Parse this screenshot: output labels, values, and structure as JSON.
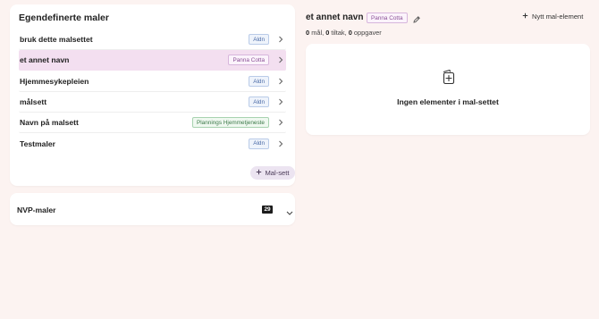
{
  "templates": {
    "title": "Egendefinerte maler",
    "items": [
      {
        "name": "bruk dette malsettet",
        "badge": "Aldn"
      },
      {
        "name": "et annet navn",
        "badge": "Panna Cotta"
      },
      {
        "name": "Hjemmesykepleien",
        "badge": "Aldn"
      },
      {
        "name": "målsett",
        "badge": "Aldn"
      },
      {
        "name": "Navn på malsett",
        "badge": "Plannings Hjemmetjeneste"
      },
      {
        "name": "Testmaler",
        "badge": "Aldn"
      }
    ],
    "add_label": "Mal-sett"
  },
  "nvp": {
    "title": "NVP-maler",
    "count": "29"
  },
  "detail": {
    "title": "et annet navn",
    "badge": "Panna Cotta",
    "new_element_label": "Nytt mal-element",
    "summary": {
      "goals_count": "0",
      "goals_label": "mål,",
      "measures_count": "0",
      "measures_label": "tiltak,",
      "tasks_count": "0",
      "tasks_label": "oppgaver"
    },
    "empty_text": "Ingen elementer i mal-settet"
  },
  "icons": {
    "row_chevron": "chevron-right-icon",
    "expand": "chevron-down-icon",
    "edit": "pencil-icon",
    "add": "plus-icon",
    "empty": "add-document-icon"
  },
  "colors": {
    "background": "#fcf3f1",
    "selected_row": "#f3dff0",
    "add_button": "#ece4f1"
  }
}
